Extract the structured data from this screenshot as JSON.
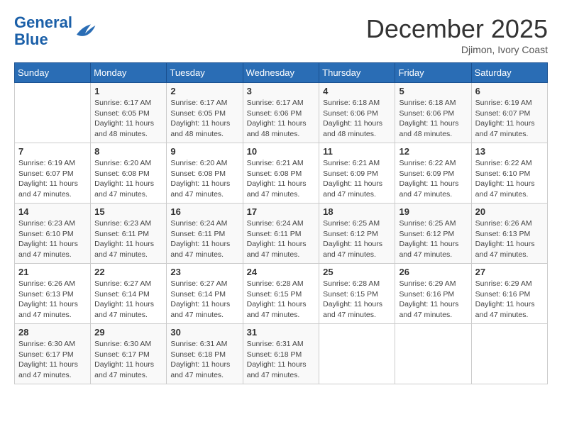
{
  "logo": {
    "line1": "General",
    "line2": "Blue"
  },
  "title": "December 2025",
  "subtitle": "Djimon, Ivory Coast",
  "days_of_week": [
    "Sunday",
    "Monday",
    "Tuesday",
    "Wednesday",
    "Thursday",
    "Friday",
    "Saturday"
  ],
  "weeks": [
    [
      {
        "day": "",
        "info": ""
      },
      {
        "day": "1",
        "info": "Sunrise: 6:17 AM\nSunset: 6:05 PM\nDaylight: 11 hours and 48 minutes."
      },
      {
        "day": "2",
        "info": "Sunrise: 6:17 AM\nSunset: 6:05 PM\nDaylight: 11 hours and 48 minutes."
      },
      {
        "day": "3",
        "info": "Sunrise: 6:17 AM\nSunset: 6:06 PM\nDaylight: 11 hours and 48 minutes."
      },
      {
        "day": "4",
        "info": "Sunrise: 6:18 AM\nSunset: 6:06 PM\nDaylight: 11 hours and 48 minutes."
      },
      {
        "day": "5",
        "info": "Sunrise: 6:18 AM\nSunset: 6:06 PM\nDaylight: 11 hours and 48 minutes."
      },
      {
        "day": "6",
        "info": "Sunrise: 6:19 AM\nSunset: 6:07 PM\nDaylight: 11 hours and 47 minutes."
      }
    ],
    [
      {
        "day": "7",
        "info": "Sunrise: 6:19 AM\nSunset: 6:07 PM\nDaylight: 11 hours and 47 minutes."
      },
      {
        "day": "8",
        "info": "Sunrise: 6:20 AM\nSunset: 6:08 PM\nDaylight: 11 hours and 47 minutes."
      },
      {
        "day": "9",
        "info": "Sunrise: 6:20 AM\nSunset: 6:08 PM\nDaylight: 11 hours and 47 minutes."
      },
      {
        "day": "10",
        "info": "Sunrise: 6:21 AM\nSunset: 6:08 PM\nDaylight: 11 hours and 47 minutes."
      },
      {
        "day": "11",
        "info": "Sunrise: 6:21 AM\nSunset: 6:09 PM\nDaylight: 11 hours and 47 minutes."
      },
      {
        "day": "12",
        "info": "Sunrise: 6:22 AM\nSunset: 6:09 PM\nDaylight: 11 hours and 47 minutes."
      },
      {
        "day": "13",
        "info": "Sunrise: 6:22 AM\nSunset: 6:10 PM\nDaylight: 11 hours and 47 minutes."
      }
    ],
    [
      {
        "day": "14",
        "info": "Sunrise: 6:23 AM\nSunset: 6:10 PM\nDaylight: 11 hours and 47 minutes."
      },
      {
        "day": "15",
        "info": "Sunrise: 6:23 AM\nSunset: 6:11 PM\nDaylight: 11 hours and 47 minutes."
      },
      {
        "day": "16",
        "info": "Sunrise: 6:24 AM\nSunset: 6:11 PM\nDaylight: 11 hours and 47 minutes."
      },
      {
        "day": "17",
        "info": "Sunrise: 6:24 AM\nSunset: 6:11 PM\nDaylight: 11 hours and 47 minutes."
      },
      {
        "day": "18",
        "info": "Sunrise: 6:25 AM\nSunset: 6:12 PM\nDaylight: 11 hours and 47 minutes."
      },
      {
        "day": "19",
        "info": "Sunrise: 6:25 AM\nSunset: 6:12 PM\nDaylight: 11 hours and 47 minutes."
      },
      {
        "day": "20",
        "info": "Sunrise: 6:26 AM\nSunset: 6:13 PM\nDaylight: 11 hours and 47 minutes."
      }
    ],
    [
      {
        "day": "21",
        "info": "Sunrise: 6:26 AM\nSunset: 6:13 PM\nDaylight: 11 hours and 47 minutes."
      },
      {
        "day": "22",
        "info": "Sunrise: 6:27 AM\nSunset: 6:14 PM\nDaylight: 11 hours and 47 minutes."
      },
      {
        "day": "23",
        "info": "Sunrise: 6:27 AM\nSunset: 6:14 PM\nDaylight: 11 hours and 47 minutes."
      },
      {
        "day": "24",
        "info": "Sunrise: 6:28 AM\nSunset: 6:15 PM\nDaylight: 11 hours and 47 minutes."
      },
      {
        "day": "25",
        "info": "Sunrise: 6:28 AM\nSunset: 6:15 PM\nDaylight: 11 hours and 47 minutes."
      },
      {
        "day": "26",
        "info": "Sunrise: 6:29 AM\nSunset: 6:16 PM\nDaylight: 11 hours and 47 minutes."
      },
      {
        "day": "27",
        "info": "Sunrise: 6:29 AM\nSunset: 6:16 PM\nDaylight: 11 hours and 47 minutes."
      }
    ],
    [
      {
        "day": "28",
        "info": "Sunrise: 6:30 AM\nSunset: 6:17 PM\nDaylight: 11 hours and 47 minutes."
      },
      {
        "day": "29",
        "info": "Sunrise: 6:30 AM\nSunset: 6:17 PM\nDaylight: 11 hours and 47 minutes."
      },
      {
        "day": "30",
        "info": "Sunrise: 6:31 AM\nSunset: 6:18 PM\nDaylight: 11 hours and 47 minutes."
      },
      {
        "day": "31",
        "info": "Sunrise: 6:31 AM\nSunset: 6:18 PM\nDaylight: 11 hours and 47 minutes."
      },
      {
        "day": "",
        "info": ""
      },
      {
        "day": "",
        "info": ""
      },
      {
        "day": "",
        "info": ""
      }
    ]
  ]
}
